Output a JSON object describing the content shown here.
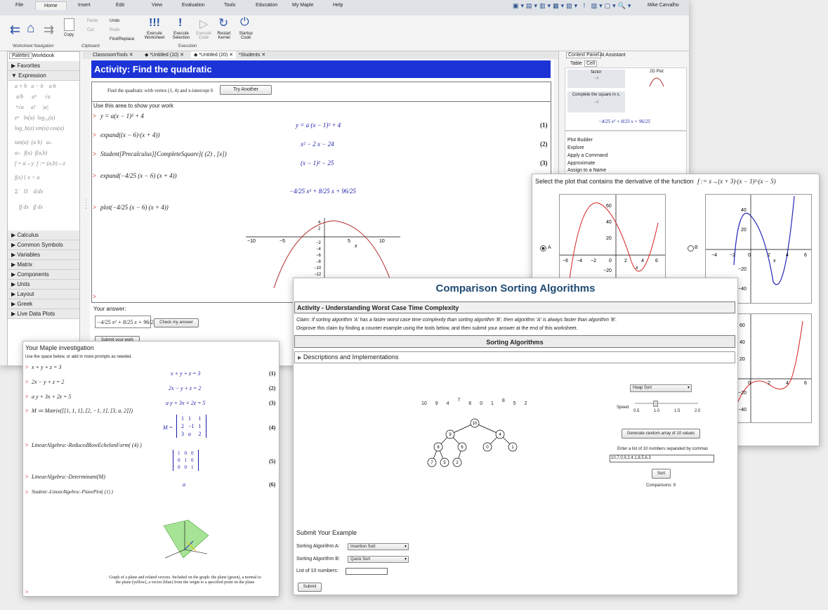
{
  "menu": [
    "File",
    "Home",
    "Insert",
    "Edit",
    "View",
    "Evaluation",
    "Tools",
    "Education",
    "My Maple",
    "Help"
  ],
  "user": "Mike Carvalho",
  "ribbon": {
    "nav_group": "Worksheet Navigation",
    "copy": "Copy",
    "paste": "Paste",
    "cut": "Cut",
    "undo": "Undo",
    "redo": "Redo",
    "find": "Find/Replace",
    "clipboard": "Clipboard",
    "execute": [
      "Execute",
      "Worksheet"
    ],
    "execute_sel": [
      "Execute",
      "Selection"
    ],
    "execute_code": [
      "Execute",
      "Code"
    ],
    "restart": [
      "Restart",
      "Kernel"
    ],
    "startup": [
      "Startup",
      "Code"
    ],
    "execution": "Execution"
  },
  "palette": {
    "tabs": [
      "Palettes",
      "Workbook"
    ],
    "favorites": "Favorites",
    "expression": "Expression",
    "categories": [
      "Calculus",
      "Common Symbols",
      "Variables",
      "Matrix",
      "Components",
      "Units",
      "Layout",
      "Greek",
      "Live Data Plots"
    ]
  },
  "doc_tabs": [
    "ClassroomTools",
    "*Untitled (10)",
    "*Untitled (20)",
    "*Students"
  ],
  "activity": {
    "title": "Activity: Find the quadratic",
    "prompt": "Find the quadratic with vertex (1, 4) and x-intercept 6",
    "try_another": "Try Another",
    "work_label": "Use this area to show your work",
    "inputs": [
      "y = a(x − 1)² + 4",
      "expand((x − 6)·(x + 4))",
      "Student[Precalculus][CompleteSquare](  (2) , [x])",
      "expand(−4/25 (x − 6) (x + 4))",
      "plot(−4/25 (x − 6) (x + 4))"
    ],
    "outputs": [
      "y = a (x − 1)² + 4",
      "x² − 2 x − 24",
      "(x − 1)² − 25",
      "−4/25 x² + 8/25 x + 96/25"
    ],
    "labels": [
      "(1)",
      "(2)",
      "(3)"
    ],
    "answer_label": "Your answer:",
    "answer": "−4/25 x² + 8/25 x + 96/25",
    "check": "Check my answer",
    "submit": "Submit your work",
    "plot_ticks_x": [
      "−10",
      "−5",
      "5",
      "10"
    ],
    "plot_ticks_y": [
      "4",
      "2",
      "−2",
      "−4",
      "−6",
      "−8",
      "−10",
      "−12"
    ],
    "x_axis_label": "x"
  },
  "context_panel": {
    "tabs": [
      "Context Panel",
      "AI Assistant"
    ],
    "subtabs": [
      "Table",
      "Cell"
    ],
    "factor": "factor",
    "factor_val": "−4",
    "plot2d": "2D Plot",
    "complete_sq": "Complete the square in x,",
    "complete_val": "−4",
    "result": "−4/25 x² + 8/25 x + 96/25",
    "items": [
      "Plot Builder",
      "Explore",
      "Apply a Command",
      "Approximate",
      "Assign to a Name"
    ]
  },
  "derivative": {
    "prompt": "Select the plot that contains the derivative of the function",
    "fn": "f := x→(x + 3)·(x − 1)²·(x − 5)",
    "opt_a": "A",
    "opt_b": "B",
    "a_y": [
      "60",
      "40",
      "20",
      "−20"
    ],
    "a_x": [
      "−6",
      "−4",
      "−2",
      "0",
      "2",
      "4",
      "6"
    ],
    "b_y": [
      "40",
      "20",
      "−20",
      "−40"
    ],
    "b_x": [
      "−4",
      "−2",
      "0",
      "2",
      "4",
      "6"
    ],
    "c_y": [
      "60",
      "40",
      "20",
      "−20",
      "−40"
    ],
    "c_x": [
      "−2",
      "0",
      "2",
      "4",
      "6"
    ],
    "x_label": "x"
  },
  "investigation": {
    "title": "Your Maple investigation",
    "sub": "Use the space below, or add in more prompts as needed.",
    "inputs": [
      "x + y + z = 3",
      "2x − y + z = 2",
      "a y + 3x + 2z = 5",
      "M ≔ Matrix([[1, 1, 1], [2, −1, 1], [3, a, 2]])",
      "LinearAlgebra:-ReducedRowEchelonForm( (4) )",
      "LinearAlgebra:-Determinant(M)",
      "Student:-LinearAlgebra:-PlanePlot( (1) )"
    ],
    "outputs": [
      "x + y + z = 3",
      "2x − y + z = 2",
      "a y + 3x + 2z = 5",
      "M ="
    ],
    "labels": [
      "(1)",
      "(2)",
      "(3)",
      "(4)",
      "(5)",
      "(6)"
    ],
    "det": "a",
    "matrix_m": [
      [
        "1",
        "1",
        "1"
      ],
      [
        "2",
        "−1",
        "1"
      ],
      [
        "3",
        "a",
        "2"
      ]
    ],
    "matrix_i": [
      [
        "1",
        "0",
        "0"
      ],
      [
        "0",
        "1",
        "0"
      ],
      [
        "0",
        "0",
        "1"
      ]
    ],
    "caption": "Graph of a plane and related vectors.  Included on the graph: the plane (green), a normal to the plane (yellow), a vector (blue) from the origin to a specified point on the plane"
  },
  "sorting": {
    "title": "Comparison Sorting Algorithms",
    "activity": "Activity - Understanding Worst Case Time Complexity",
    "claim": "Claim: If sorting algorithm 'A' has a faster worst case time complexity than sorting algorithm 'B', then algorithm 'A' is always faster than algorithm 'B'.",
    "disprove": "Disprove this claim by finding a counter example using the tools below, and then submit your answer at the end of this worksheet.",
    "section": "Sorting Algorithms",
    "desc": "Descriptions and Implementations",
    "numbers": [
      "10",
      "9",
      "4",
      "7",
      "6",
      "0",
      "1",
      "8",
      "5",
      "2"
    ],
    "heap_nodes": [
      "10",
      "9",
      "4",
      "8",
      "6",
      "0",
      "1",
      "7",
      "5",
      "2"
    ],
    "algo_select": "Heap Sort",
    "speed": "Speed",
    "speed_ticks": [
      "0.5",
      "1.0",
      "1.5",
      "2.0"
    ],
    "generate": "Generate random array of 10 values",
    "enter": "Enter a list of 10 numbers separated by commas",
    "list_value": "10,7,0,9,2,4,1,8,5,6,3",
    "sort": "Sort",
    "comparisons": "Comparisons: 9",
    "submit_title": "Submit Your Example",
    "alg_a": "Sorting Algorithm A:",
    "alg_a_val": "Insertion Sort",
    "alg_b": "Sorting Algorithm B:",
    "alg_b_val": "Quick Sort",
    "list_label": "List of 10 numbers:",
    "submit": "Submit"
  },
  "colors": {
    "accent": "#1c34d6",
    "plot_red": "#b02a2a",
    "plot_blue": "#2424b8",
    "title_blue": "#1f4a73",
    "plane_green": "#9de08a"
  }
}
